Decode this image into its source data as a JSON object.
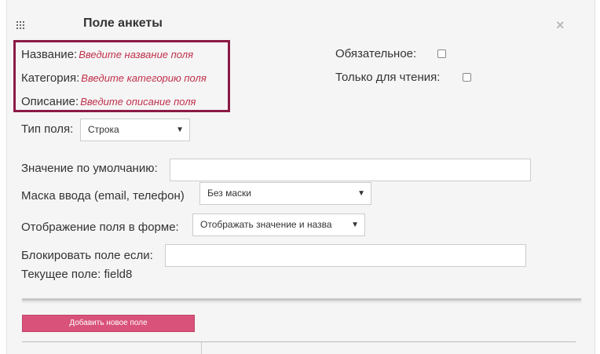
{
  "header": {
    "title": "Поле анкеты",
    "close_label": "×"
  },
  "fields": {
    "name": {
      "label": "Название:",
      "placeholder": "Введите название поля"
    },
    "category": {
      "label": "Категория:",
      "placeholder": "Введите категорию поля"
    },
    "description": {
      "label": "Описание:",
      "placeholder": "Введите описание поля"
    }
  },
  "options": {
    "required_label": "Обязательное:",
    "required_checked": false,
    "readonly_label": "Только для чтения:",
    "readonly_checked": false
  },
  "field_type": {
    "label": "Тип поля:",
    "value": "Строка"
  },
  "default_value": {
    "label": "Значение по умолчанию:",
    "value": ""
  },
  "input_mask": {
    "label": "Маска ввода (email, телефон)",
    "value": "Без маски"
  },
  "display": {
    "label": "Отображение поля в форме:",
    "value": "Отображать значение и назва"
  },
  "block_if": {
    "label": "Блокировать поле если:",
    "value": ""
  },
  "current_field": {
    "text": "Текущее поле: field8"
  },
  "actions": {
    "add_field_label": "Добавить новое поле"
  },
  "colors": {
    "accent": "#d9527a",
    "highlight_border": "#8b1a45",
    "placeholder": "#c0304a"
  }
}
